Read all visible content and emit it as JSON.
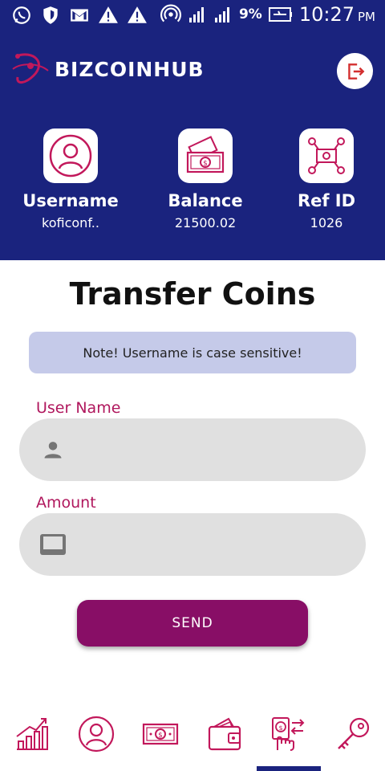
{
  "status_bar": {
    "battery_percent": "9%",
    "time": "10:27",
    "ampm": "PM",
    "icons": [
      "whatsapp-icon",
      "shield-icon",
      "gmail-icon",
      "warning-icon",
      "warning-icon",
      "hotspot-icon",
      "signal-icon",
      "signal-icon",
      "battery-icon"
    ]
  },
  "header": {
    "logo_text": "BIZCOINHUB",
    "logout_icon": "logout-icon"
  },
  "stats": [
    {
      "label": "Username",
      "value": "koficonf..",
      "icon": "user-icon"
    },
    {
      "label": "Balance",
      "value": "21500.02",
      "icon": "money-icon"
    },
    {
      "label": "Ref ID",
      "value": "1026",
      "icon": "network-icon"
    }
  ],
  "page": {
    "title": "Transfer Coins",
    "note": "Note! Username is case sensitive!"
  },
  "form": {
    "username_label": "User Name",
    "username_value": "",
    "amount_label": "Amount",
    "amount_value": "",
    "send_label": "SEND"
  },
  "nav": {
    "items": [
      "chart-icon",
      "profile-icon",
      "cash-icon",
      "wallet-icon",
      "transfer-icon",
      "key-icon"
    ],
    "active_index": 4
  },
  "colors": {
    "primary": "#1a237e",
    "accent": "#b0175d",
    "button": "#880e66",
    "note_bg": "#c5cae9",
    "field_bg": "#e0e0e0"
  }
}
